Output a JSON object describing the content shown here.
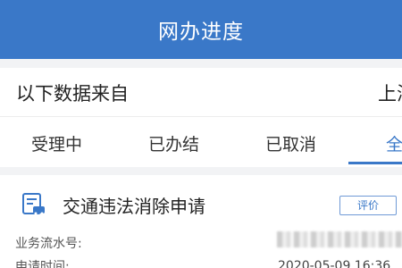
{
  "header": {
    "title": "网办进度"
  },
  "source": {
    "label": "以下数据来自",
    "value": "上海"
  },
  "tabs": [
    {
      "label": "受理中",
      "selected": false
    },
    {
      "label": "已办结",
      "selected": false
    },
    {
      "label": "已取消",
      "selected": false
    },
    {
      "label": "全部",
      "selected": true
    }
  ],
  "card": {
    "icon": "vehicle-document-icon",
    "title": "交通违法消除申请",
    "rate_button": "评价",
    "fields": {
      "serial_label": "业务流水号:",
      "apply_time_label": "申请时间:",
      "apply_time_value": "2020-05-09 16:36"
    }
  },
  "colors": {
    "header_bg": "#3a78c8",
    "accent": "#3a78c8",
    "page_bg": "#f2f3f5"
  }
}
